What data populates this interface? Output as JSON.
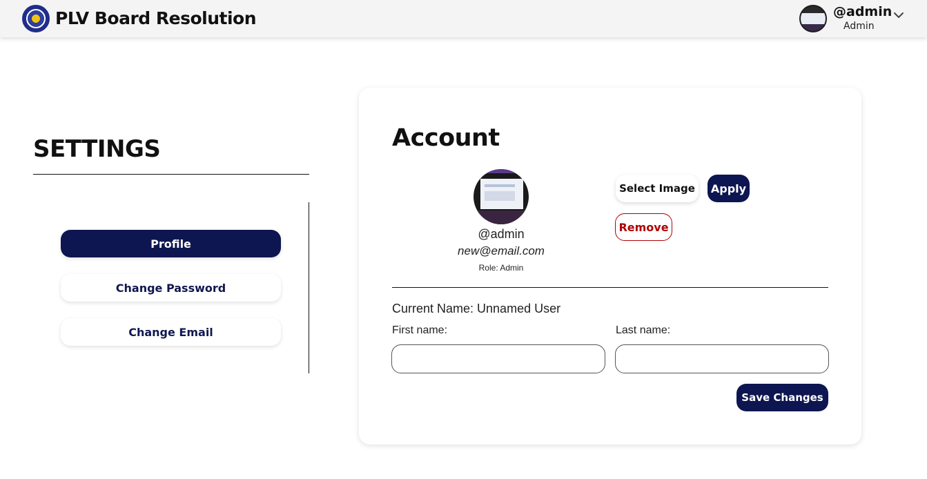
{
  "header": {
    "app_title": "PLV Board Resolution",
    "user_handle": "@admin",
    "user_role": "Admin"
  },
  "settings": {
    "title": "SETTINGS",
    "nav": [
      {
        "label": "Profile",
        "active": true
      },
      {
        "label": "Change Password",
        "active": false
      },
      {
        "label": "Change Email",
        "active": false
      }
    ]
  },
  "account": {
    "title": "Account",
    "handle": "@admin",
    "email": "new@email.com",
    "role_text": "Role: Admin",
    "select_image_label": "Select Image",
    "apply_label": "Apply",
    "remove_label": "Remove",
    "current_name": "Current Name: Unnamed User",
    "first_name_label": "First name:",
    "last_name_label": "Last name:",
    "first_name_value": "",
    "last_name_value": "",
    "save_label": "Save Changes"
  },
  "colors": {
    "primary": "#0d1650",
    "danger": "#b00000",
    "header_bg": "#f4f4f4"
  }
}
